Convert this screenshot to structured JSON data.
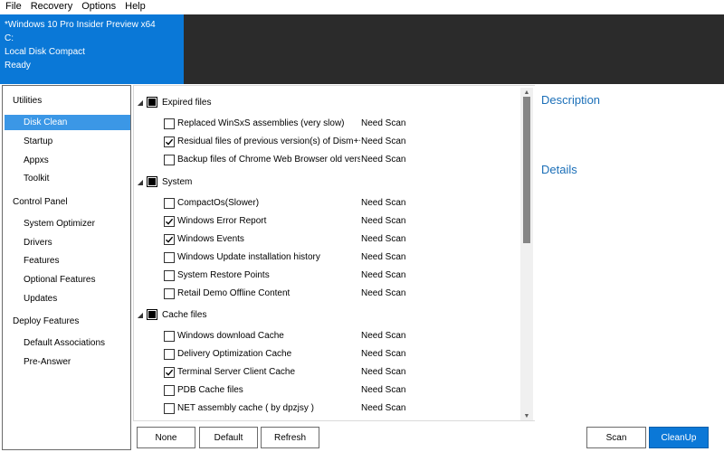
{
  "menu": [
    "File",
    "Recovery",
    "Options",
    "Help"
  ],
  "info": {
    "os": "*Windows 10 Pro Insider Preview x64",
    "drive": "C:",
    "disk": "Local Disk Compact",
    "status": "Ready"
  },
  "sidebar": {
    "groups": [
      {
        "label": "Utilities",
        "items": [
          "Disk Clean",
          "Startup",
          "Appxs",
          "Toolkit"
        ]
      },
      {
        "label": "Control Panel",
        "items": [
          "System Optimizer",
          "Drivers",
          "Features",
          "Optional Features",
          "Updates"
        ]
      },
      {
        "label": "Deploy Features",
        "items": [
          "Default Associations",
          "Pre-Answer"
        ]
      }
    ],
    "selected": "Disk Clean"
  },
  "list": {
    "groups": [
      {
        "label": "Expired files",
        "items": [
          {
            "label": "Replaced WinSxS assemblies (very slow)",
            "checked": false,
            "status": "Need Scan"
          },
          {
            "label": "Residual files of previous version(s) of Dism++",
            "checked": true,
            "status": "Need Scan"
          },
          {
            "label": "Backup files of Chrome Web Browser old version",
            "checked": false,
            "status": "Need Scan"
          }
        ]
      },
      {
        "label": "System",
        "items": [
          {
            "label": "CompactOs(Slower)",
            "checked": false,
            "status": "Need Scan"
          },
          {
            "label": "Windows Error Report",
            "checked": true,
            "status": "Need Scan"
          },
          {
            "label": "Windows Events",
            "checked": true,
            "status": "Need Scan"
          },
          {
            "label": "Windows Update installation history",
            "checked": false,
            "status": "Need Scan"
          },
          {
            "label": "System Restore Points",
            "checked": false,
            "status": "Need Scan"
          },
          {
            "label": "Retail Demo Offline Content",
            "checked": false,
            "status": "Need Scan"
          }
        ]
      },
      {
        "label": "Cache files",
        "items": [
          {
            "label": "Windows download Cache",
            "checked": false,
            "status": "Need Scan"
          },
          {
            "label": "Delivery Optimization Cache",
            "checked": false,
            "status": "Need Scan"
          },
          {
            "label": "Terminal Server Client Cache",
            "checked": true,
            "status": "Need Scan"
          },
          {
            "label": "PDB Cache files",
            "checked": false,
            "status": "Need Scan"
          },
          {
            "label": "NET assembly cache ( by dpzjsy )",
            "checked": false,
            "status": "Need Scan"
          }
        ]
      }
    ]
  },
  "right": {
    "description": "Description",
    "details": "Details"
  },
  "buttons": {
    "none": "None",
    "default": "Default",
    "refresh": "Refresh",
    "scan": "Scan",
    "cleanup": "CleanUp"
  },
  "colors": {
    "accent": "#0b78d7",
    "selection": "#3b97e6",
    "header_dark": "#2b2b2b",
    "title_blue": "#1b6fb8"
  }
}
